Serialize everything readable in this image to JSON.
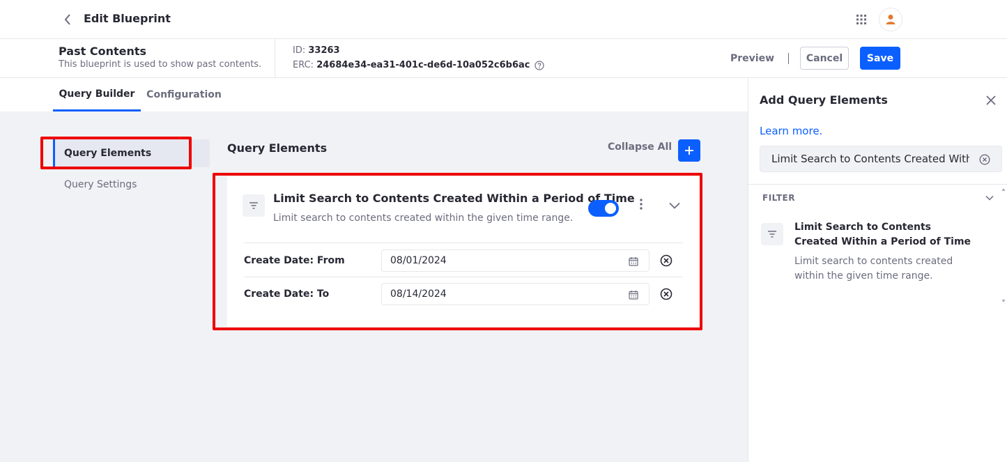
{
  "topbar": {
    "title": "Edit Blueprint"
  },
  "blueprint": {
    "name": "Past Contents",
    "description": "This blueprint is used to show past contents.",
    "id_label": "ID:",
    "id_value": "33263",
    "erc_label": "ERC:",
    "erc_value": "24684e34-ea31-401c-de6d-10a052c6b6ac"
  },
  "actions": {
    "preview": "Preview",
    "cancel": "Cancel",
    "save": "Save"
  },
  "tabs": [
    {
      "label": "Query Builder",
      "active": true
    },
    {
      "label": "Configuration",
      "active": false
    }
  ],
  "nav": {
    "items": [
      {
        "label": "Query Elements"
      },
      {
        "label": "Query Settings"
      }
    ]
  },
  "query_elements": {
    "title": "Query Elements",
    "collapse_all": "Collapse All",
    "card": {
      "title": "Limit Search to Contents Created Within a Period of Time",
      "description": "Limit search to contents created within the given time range.",
      "enabled": true,
      "fields": [
        {
          "label": "Create Date: From",
          "value": "08/01/2024"
        },
        {
          "label": "Create Date: To",
          "value": "08/14/2024"
        }
      ]
    }
  },
  "sidebar": {
    "title": "Add Query Elements",
    "learn_more": "Learn more.",
    "search_value": "Limit Search to Contents Created Withi",
    "filter_label": "FILTER",
    "result": {
      "title": "Limit Search to Contents Created Within a Period of Time",
      "description": "Limit search to contents created within the given time range."
    }
  },
  "colors": {
    "accent": "#0b5fff",
    "highlight": "#ee0000",
    "avatar": "#e07a2e"
  },
  "icons": [
    "back-icon",
    "apps-grid-icon",
    "user-icon",
    "help-icon",
    "filter-icon",
    "kebab-icon",
    "chevron-down-icon",
    "calendar-icon",
    "clear-icon",
    "close-icon",
    "plus-icon"
  ]
}
